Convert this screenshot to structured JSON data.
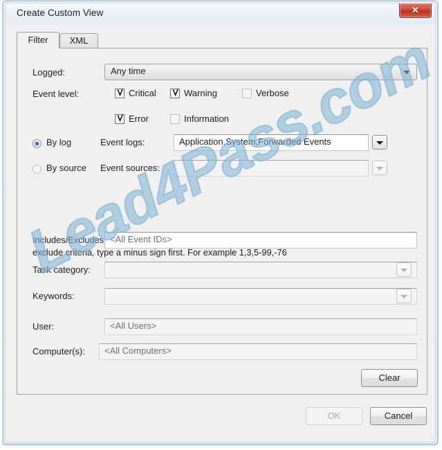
{
  "window": {
    "title": "Create Custom View",
    "close_label": "✕",
    "close_icon": "close-icon"
  },
  "tabs": [
    {
      "label": "Filter",
      "active": true
    },
    {
      "label": "XML",
      "active": false
    }
  ],
  "filter": {
    "logged": {
      "label": "Logged:",
      "value": "Any time"
    },
    "event_level": {
      "label": "Event level:",
      "items": [
        {
          "label": "Critical",
          "checked": true
        },
        {
          "label": "Warning",
          "checked": true
        },
        {
          "label": "Verbose",
          "checked": false
        },
        {
          "label": "Error",
          "checked": true
        },
        {
          "label": "Information",
          "checked": false
        }
      ]
    },
    "source_mode": {
      "by_log": {
        "label": "By log",
        "selected": true
      },
      "by_source": {
        "label": "By source",
        "selected": false
      }
    },
    "event_logs": {
      "label": "Event logs:",
      "value": "Application,System,Forwarded Events"
    },
    "event_sources": {
      "label": "Event sources:",
      "value": ""
    },
    "event_ids_help": "Includes/Excludes Event IDs: Enter ID numbers and/or ID ranges separated by commas. To exclude criteria, type a minus sign first. For example 1,3,5-99,-76",
    "event_ids": {
      "placeholder": "<All Event IDs>",
      "value": ""
    },
    "task_category": {
      "label": "Task category:",
      "value": ""
    },
    "keywords": {
      "label": "Keywords:",
      "value": ""
    },
    "user": {
      "label": "User:",
      "placeholder": "<All Users>",
      "value": ""
    },
    "computers": {
      "label": "Computer(s):",
      "placeholder": "<All Computers>",
      "value": ""
    },
    "clear_button": "Clear"
  },
  "footer": {
    "ok_button": "OK",
    "ok_enabled": false,
    "cancel_button": "Cancel"
  },
  "watermark": {
    "text": "Lead4Pass.com",
    "color": "#7db2d4"
  },
  "colors": {
    "accent": "#2a6fb5",
    "close_red": "#b8331f",
    "dialog_background": "#f0f0f0",
    "frame_blue": "#9cb6cd"
  }
}
